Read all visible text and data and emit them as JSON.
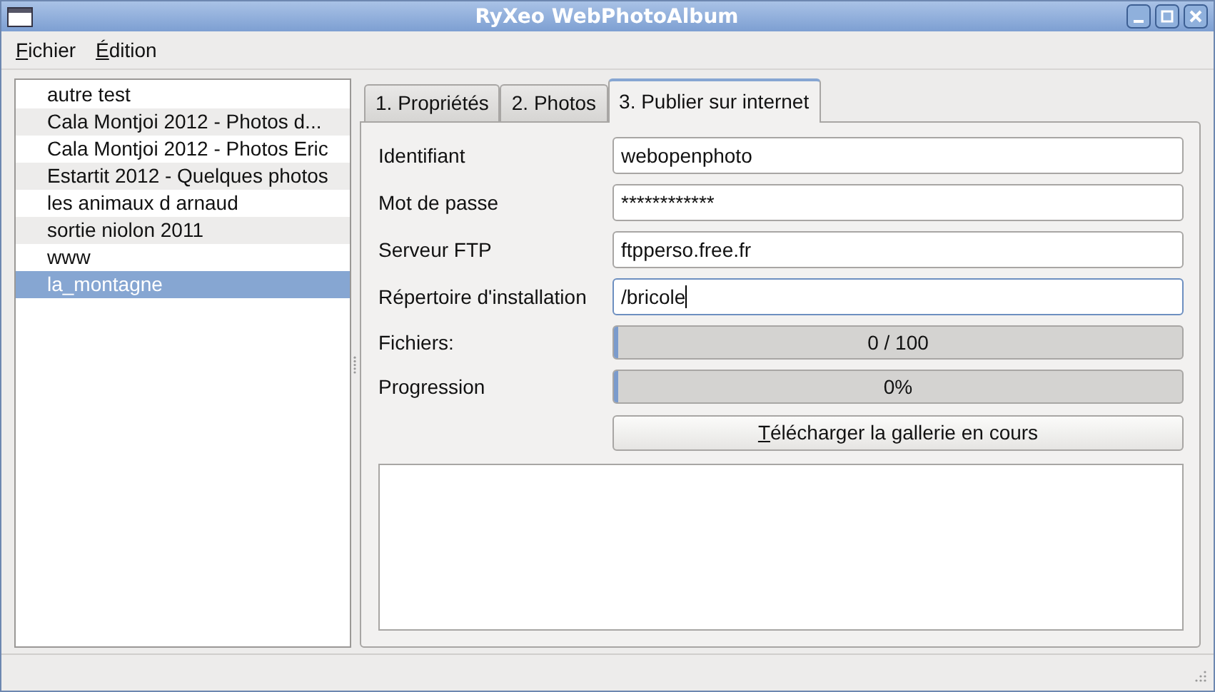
{
  "window": {
    "title": "RyXeo WebPhotoAlbum"
  },
  "menu": [
    "Fichier",
    "Édition"
  ],
  "albums": [
    {
      "label": "autre test",
      "selected": false
    },
    {
      "label": "Cala Montjoi 2012 - Photos d...",
      "selected": false
    },
    {
      "label": "Cala Montjoi 2012 - Photos Eric",
      "selected": false
    },
    {
      "label": "Estartit 2012 - Quelques photos",
      "selected": false
    },
    {
      "label": "les animaux d arnaud",
      "selected": false
    },
    {
      "label": "sortie niolon 2011",
      "selected": false
    },
    {
      "label": "www",
      "selected": false
    },
    {
      "label": "la_montagne",
      "selected": true
    }
  ],
  "tabs": [
    {
      "label": "1. Propriétés",
      "selected": false
    },
    {
      "label": "2. Photos",
      "selected": false
    },
    {
      "label": "3. Publier sur internet",
      "selected": true
    }
  ],
  "fields": [
    {
      "label": "Identifiant",
      "value": "webopenphoto",
      "focused": false
    },
    {
      "label": "Mot de passe",
      "value": "************",
      "focused": false
    },
    {
      "label": "Serveur FTP",
      "value": "ftpperso.free.fr",
      "focused": false
    },
    {
      "label": "Répertoire d'installation",
      "value": "/bricole",
      "focused": true
    }
  ],
  "progress": [
    {
      "label": "Fichiers:",
      "level": 0,
      "reading": "0 / 100"
    },
    {
      "label": "Progression",
      "level": 0,
      "reading": "0%"
    }
  ],
  "upload_button": "Télécharger la gallerie en cours"
}
